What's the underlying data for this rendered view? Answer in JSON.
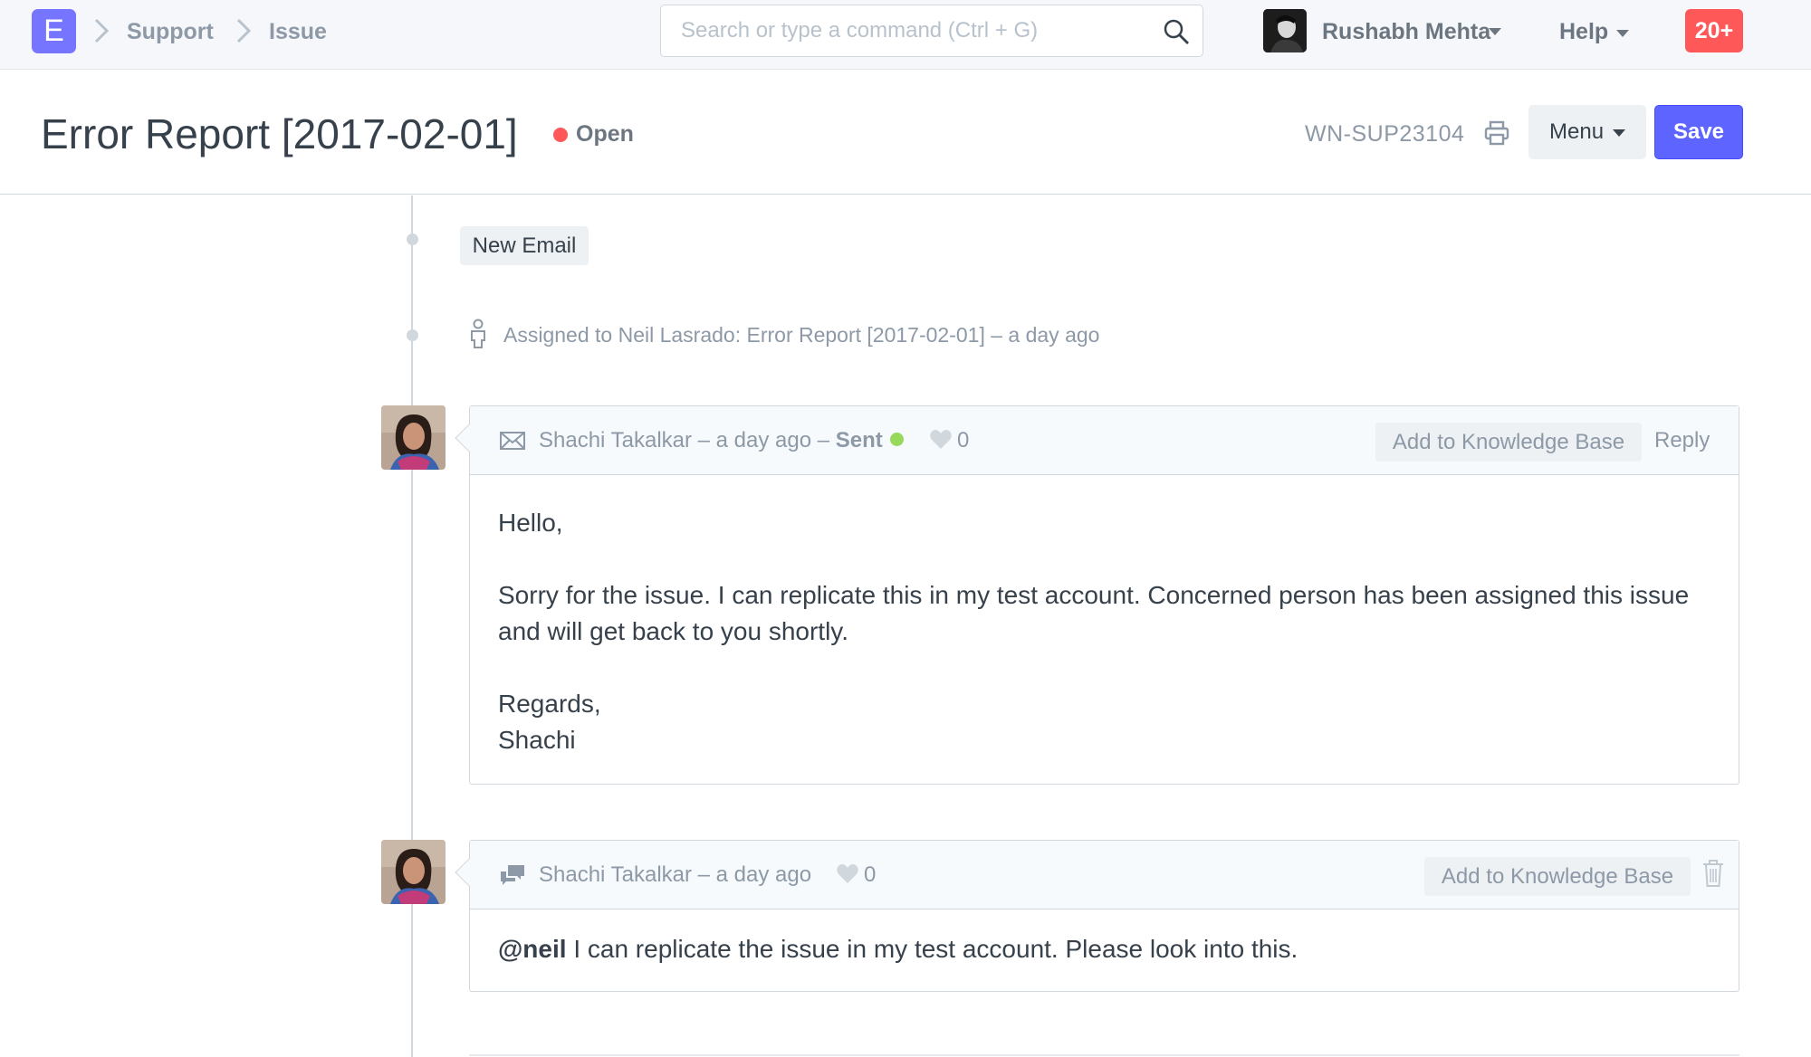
{
  "navbar": {
    "logo_letter": "E",
    "breadcrumbs": [
      "Support",
      "Issue"
    ],
    "search_placeholder": "Search or type a command (Ctrl + G)",
    "user_name": "Rushabh Mehta",
    "help_label": "Help",
    "notification_count": "20+"
  },
  "page_head": {
    "title": "Error Report [2017-02-01]",
    "status": "Open",
    "status_color": "#ff5858",
    "doc_id": "WN-SUP23104",
    "menu_label": "Menu",
    "save_label": "Save"
  },
  "timeline": {
    "new_email_label": "New Email",
    "assignment_text": "Assigned to Neil Lasrado: Error Report [2017-02-01] – a day ago",
    "email": {
      "header_text": "Shachi Takalkar – a day ago – ",
      "sent_label": "Sent",
      "likes": "0",
      "kb_label": "Add to Knowledge Base",
      "reply_label": "Reply",
      "body": {
        "greeting": "Hello,",
        "paragraph": "Sorry for the issue. I can replicate this in my test account. Concerned person has been assigned this issue and will get back to you shortly.",
        "regards": "Regards,",
        "signature": "Shachi"
      }
    },
    "comment": {
      "header_text": "Shachi Takalkar – a day ago",
      "likes": "0",
      "kb_label": "Add to Knowledge Base",
      "mention": "@neil",
      "text": " I can replicate the issue in my test account. Please look into this."
    }
  },
  "colors": {
    "brand": "#7575ff",
    "primary": "#5e64ff",
    "danger": "#ff5858",
    "success": "#98d85b"
  }
}
